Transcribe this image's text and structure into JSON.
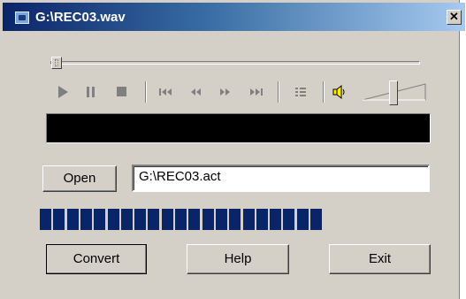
{
  "window": {
    "title": "G:\\REC03.wav",
    "close_label": "✕"
  },
  "transport": {
    "icons": [
      "play-icon",
      "pause-icon",
      "stop-icon",
      "skip-start-icon",
      "rewind-icon",
      "fast-forward-icon",
      "skip-end-icon",
      "playlist-icon",
      "speaker-icon"
    ]
  },
  "file": {
    "open_label": "Open",
    "path_value": "G:\\REC03.act"
  },
  "progress": {
    "filled_fraction": 1.0,
    "segments": 21
  },
  "buttons": {
    "convert_label": "Convert",
    "help_label": "Help",
    "exit_label": "Exit"
  },
  "colors": {
    "progress": "#0a246a",
    "face": "#d4d0c8",
    "display": "#000000"
  }
}
